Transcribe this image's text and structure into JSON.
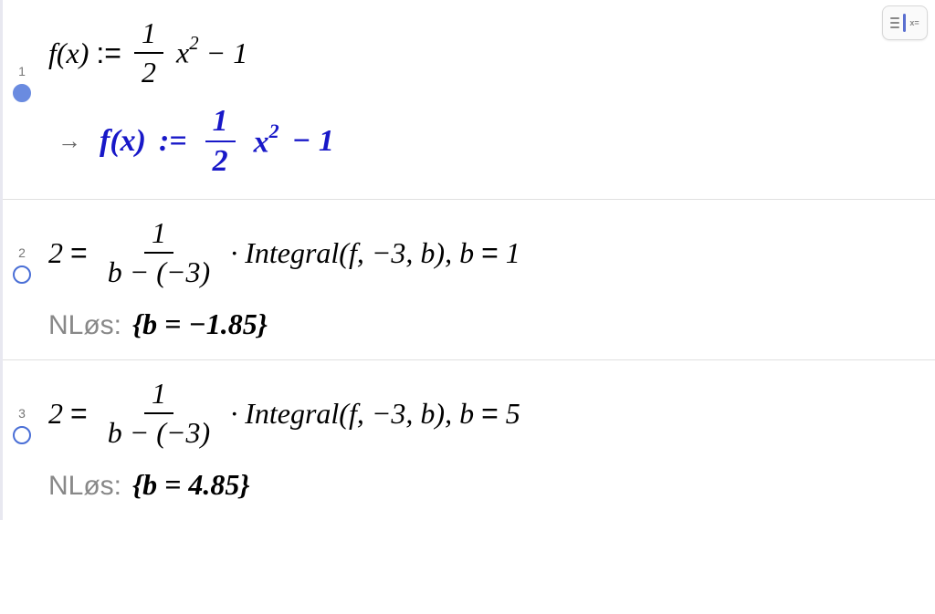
{
  "toolbar": {
    "icon_label": "x="
  },
  "rows": [
    {
      "index": "1",
      "filled": true,
      "input": {
        "lhs": "f(x)",
        "op": ":=",
        "frac_num": "1",
        "frac_den": "2",
        "var": "x",
        "exp": "2",
        "tail": "− 1"
      },
      "output": {
        "arrow": "→",
        "lhs": "f(x)",
        "op": ":=",
        "frac_num": "1",
        "frac_den": "2",
        "var": "x",
        "exp": "2",
        "tail": "− 1"
      }
    },
    {
      "index": "2",
      "filled": false,
      "input": {
        "lhs": "2",
        "eq": "=",
        "frac_num": "1",
        "frac_den": "b − (−3)",
        "dot": "·",
        "integral": "Integral(f, −3, b), b",
        "eq2": "=",
        "rhs": "1"
      },
      "solver_label": "NLøs:",
      "solver_result": "{b = −1.85}"
    },
    {
      "index": "3",
      "filled": false,
      "input": {
        "lhs": "2",
        "eq": "=",
        "frac_num": "1",
        "frac_den": "b − (−3)",
        "dot": "·",
        "integral": "Integral(f, −3, b), b",
        "eq2": "=",
        "rhs": "5"
      },
      "solver_label": "NLøs:",
      "solver_result": "{b = 4.85}"
    }
  ]
}
